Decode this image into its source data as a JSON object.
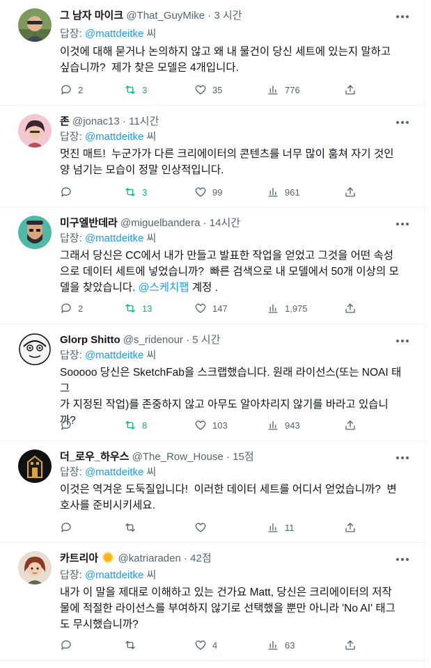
{
  "colors": {
    "accent": "#1d9bf0",
    "retweet": "#00ba7c",
    "muted": "#536471",
    "text": "#0f1419",
    "divider": "#eff3f4"
  },
  "icons": {
    "more": "more-dots-icon",
    "reply": "reply-icon",
    "retweet": "retweet-icon",
    "like": "heart-icon",
    "views": "views-bar-icon",
    "share": "share-icon"
  },
  "tweets": [
    {
      "name": "그 남자 마이크",
      "handle": "@That_GuyMike",
      "dot": "·",
      "time": "3 시간",
      "reply_prefix": "답장:",
      "reply_mention": "@mattdeitke",
      "reply_suffix": " 씨",
      "text": "이것에 대해 묻거나 논의하지 않고 왜 내 물건이 당신 세트에 있는지 말하고\n싶습니까?  제가 찾은 모델은 4개입니다.",
      "replies": "2",
      "retweets": "3",
      "likes": "35",
      "views": "776"
    },
    {
      "name": "존",
      "handle": "@jonac13",
      "dot": "·",
      "time": "11시간",
      "reply_prefix": "답장:",
      "reply_mention": "@mattdeitke",
      "reply_suffix": " 씨",
      "text": "멋진 매트!  누군가가 다른 크리에이터의 콘텐츠를 너무 많이 훔쳐 자기 것인\n양 넘기는 모습이 정말 인상적입니다.",
      "replies": "",
      "retweets": "3",
      "likes": "99",
      "views": "961"
    },
    {
      "name": "미구엘반데라",
      "handle": "@miguelbandera",
      "dot": "·",
      "time": "14시간",
      "reply_prefix": "답장:",
      "reply_mention": "@mattdeitke",
      "reply_suffix": " 씨",
      "text": "그래서 당신은 CC에서 내가 만들고 발표한 작업을 얻었고 그것을 어떤 속성\n으로 데이터 세트에 넣었습니까?  빠른 검색으로 내 모델에서 50개 이상의 모\n델을 찾았습니다. ",
      "text_link": "@스케치팹",
      "text_after": " 계정 .",
      "replies": "2",
      "retweets": "13",
      "likes": "147",
      "views": "1,975"
    },
    {
      "name": "Glorp Shitto",
      "handle": "@s_ridenour",
      "dot": "·",
      "time": "5 시간",
      "reply_prefix": "답장:",
      "reply_mention": "@mattdeitke",
      "reply_suffix": " 씨",
      "text": "Sooooo 당신은 SketchFab을 스크랩했습니다. 원래 라이선스(또는 NOAI 태그\n가 지정된 작업)를 존중하지 않고 아무도 알아차리지 않기를 바라고 있습니\n까?",
      "replies": "",
      "retweets": "8",
      "likes": "103",
      "views": "943"
    },
    {
      "name": "더_로우_하우스",
      "handle": "@The_Row_House",
      "dot": "·",
      "time": "15점",
      "reply_prefix": "답장:",
      "reply_mention": "@mattdeitke",
      "reply_suffix": " 씨",
      "text": "이것은 역겨운 도둑질입니다!  이러한 데이터 세트를 어디서 얻었습니까?  변\n호사를 준비시키세요.",
      "replies": "",
      "retweets": "",
      "likes": "",
      "views": "11"
    },
    {
      "name": "카트리아",
      "handle": "@katriaraden",
      "dot": "·",
      "time": "42점",
      "reply_prefix": "답장:",
      "reply_mention": "@mattdeitke",
      "reply_suffix": " 씨",
      "text": "내가 이 말을 제대로 이해하고 있는 건가요 Matt, 당신은 크리에이터의 저작\n물에 적절한 라이선스를 부여하지 않기로 선택했을 뿐만 아니라 'No AI' 태그\n도 무시했습니까?",
      "replies": "",
      "retweets": "",
      "likes": "4",
      "views": "63"
    }
  ]
}
